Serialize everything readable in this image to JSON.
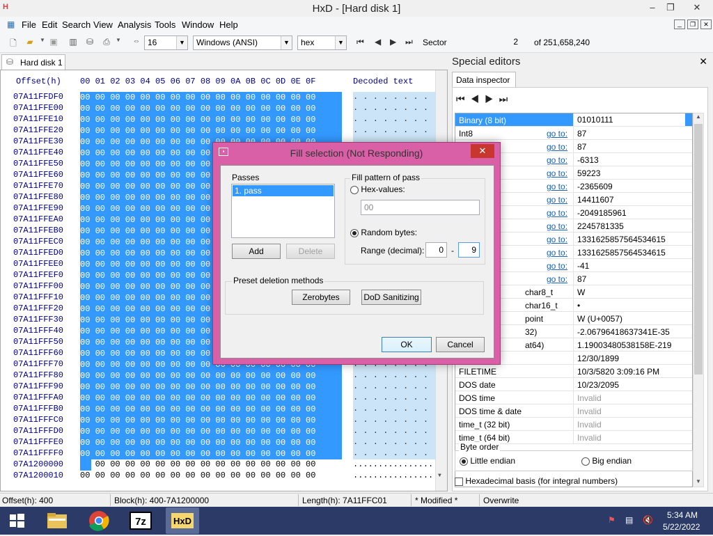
{
  "window": {
    "title": "HxD - [Hard disk 1]",
    "min": "–",
    "max": "❐",
    "close": "✕"
  },
  "menu": [
    "File",
    "Edit",
    "Search",
    "View",
    "Analysis",
    "Tools",
    "Window",
    "Help"
  ],
  "toolbar": {
    "bytes_per_row": "16",
    "charset": "Windows (ANSI)",
    "mode": "hex",
    "sector_label": "Sector",
    "sector_value": "2",
    "sector_total": "of 251,658,240"
  },
  "doc_tab": "Hard disk 1",
  "hex": {
    "header_offset": "Offset(h)",
    "header_cols": "00 01 02 03 04 05 06 07 08 09 0A 0B 0C 0D 0E 0F",
    "header_decoded": "Decoded text",
    "rows": [
      "07A11FFDF0",
      "07A11FFE00",
      "07A11FFE10",
      "07A11FFE20",
      "07A11FFE30",
      "07A11FFE40",
      "07A11FFE50",
      "07A11FFE60",
      "07A11FFE70",
      "07A11FFE80",
      "07A11FFE90",
      "07A11FFEA0",
      "07A11FFEB0",
      "07A11FFEC0",
      "07A11FFED0",
      "07A11FFEE0",
      "07A11FFEF0",
      "07A11FFF00",
      "07A11FFF10",
      "07A11FFF20",
      "07A11FFF30",
      "07A11FFF40",
      "07A11FFF50",
      "07A11FFF60",
      "07A11FFF70",
      "07A11FFF80",
      "07A11FFF90",
      "07A11FFFA0",
      "07A11FFFB0",
      "07A11FFFC0",
      "07A11FFFD0",
      "07A11FFFE0",
      "07A11FFFF0"
    ],
    "last_rows": [
      "07A1200000",
      "07A1200010"
    ],
    "bytes": "00 00 00 00 00 00 00 00 00 00 00 00 00 00 00 00",
    "decoded_sel": ". . . . . . . . . . . . . . . .",
    "decoded_plain": "................"
  },
  "side": {
    "title": "Special editors",
    "tab": "Data inspector",
    "rows": [
      {
        "label": "Binary (8 bit)",
        "goto": "",
        "value": "01010111",
        "hl": true
      },
      {
        "label": "Int8",
        "goto": "go to:",
        "value": "87"
      },
      {
        "label": "",
        "goto": "go to:",
        "value": "87"
      },
      {
        "label": "",
        "goto": "go to:",
        "value": "-6313"
      },
      {
        "label": "",
        "goto": "go to:",
        "value": "59223"
      },
      {
        "label": "",
        "goto": "go to:",
        "value": "-2365609"
      },
      {
        "label": "",
        "goto": "go to:",
        "value": "14411607"
      },
      {
        "label": "",
        "goto": "go to:",
        "value": "-2049185961"
      },
      {
        "label": "",
        "goto": "go to:",
        "value": "2245781335"
      },
      {
        "label": "",
        "goto": "go to:",
        "value": "1331625857564534615"
      },
      {
        "label": "",
        "goto": "go to:",
        "value": "1331625857564534615"
      },
      {
        "label": "",
        "goto": "go to:",
        "value": "-41"
      },
      {
        "label": "",
        "goto": "go to:",
        "value": "87"
      },
      {
        "label": "char8_t",
        "goto": "",
        "value": "W",
        "indent": true
      },
      {
        "label": "char16_t",
        "goto": "",
        "value": "•",
        "indent": true
      },
      {
        "label": "point",
        "goto": "",
        "value": "W (U+0057)",
        "indent": true
      },
      {
        "label": "32)",
        "goto": "",
        "value": "-2.06796418637341E-35",
        "indent": true
      },
      {
        "label": "at64)",
        "goto": "",
        "value": "1.19003480538158E-219",
        "indent": true
      },
      {
        "label": "",
        "goto": "",
        "value": "12/30/1899"
      },
      {
        "label": "FILETIME",
        "goto": "",
        "value": "10/3/5820 3:09:16 PM"
      },
      {
        "label": "DOS date",
        "goto": "",
        "value": "10/23/2095"
      },
      {
        "label": "DOS time",
        "goto": "",
        "value": "Invalid",
        "gray": true
      },
      {
        "label": "DOS time & date",
        "goto": "",
        "value": "Invalid",
        "gray": true
      },
      {
        "label": "time_t (32 bit)",
        "goto": "",
        "value": "Invalid",
        "gray": true
      },
      {
        "label": "time_t (64 bit)",
        "goto": "",
        "value": "Invalid",
        "gray": true
      }
    ],
    "byte_order": "Byte order",
    "little": "Little endian",
    "big": "Big endian",
    "hexbasis": "Hexadecimal basis (for integral numbers)"
  },
  "status": {
    "offset": "Offset(h): 400",
    "block": "Block(h): 400-7A1200000",
    "length": "Length(h): 7A11FFC01",
    "modified": "* Modified *",
    "mode": "Overwrite"
  },
  "tray": {
    "time": "5:34 AM",
    "date": "5/22/2022"
  },
  "dialog": {
    "title": "Fill selection (Not Responding)",
    "passes_label": "Passes",
    "pass_item": "1. pass",
    "add": "Add",
    "delete": "Delete",
    "fill_label": "Fill pattern of pass",
    "hex_values": "Hex-values:",
    "hex_input": "00",
    "random": "Random bytes:",
    "range": "Range (decimal):",
    "range_from": "0",
    "range_dash": "-",
    "range_to": "9",
    "preset_label": "Preset deletion methods",
    "zerobytes": "Zerobytes",
    "dod": "DoD Sanitizing",
    "ok": "OK",
    "cancel": "Cancel"
  }
}
